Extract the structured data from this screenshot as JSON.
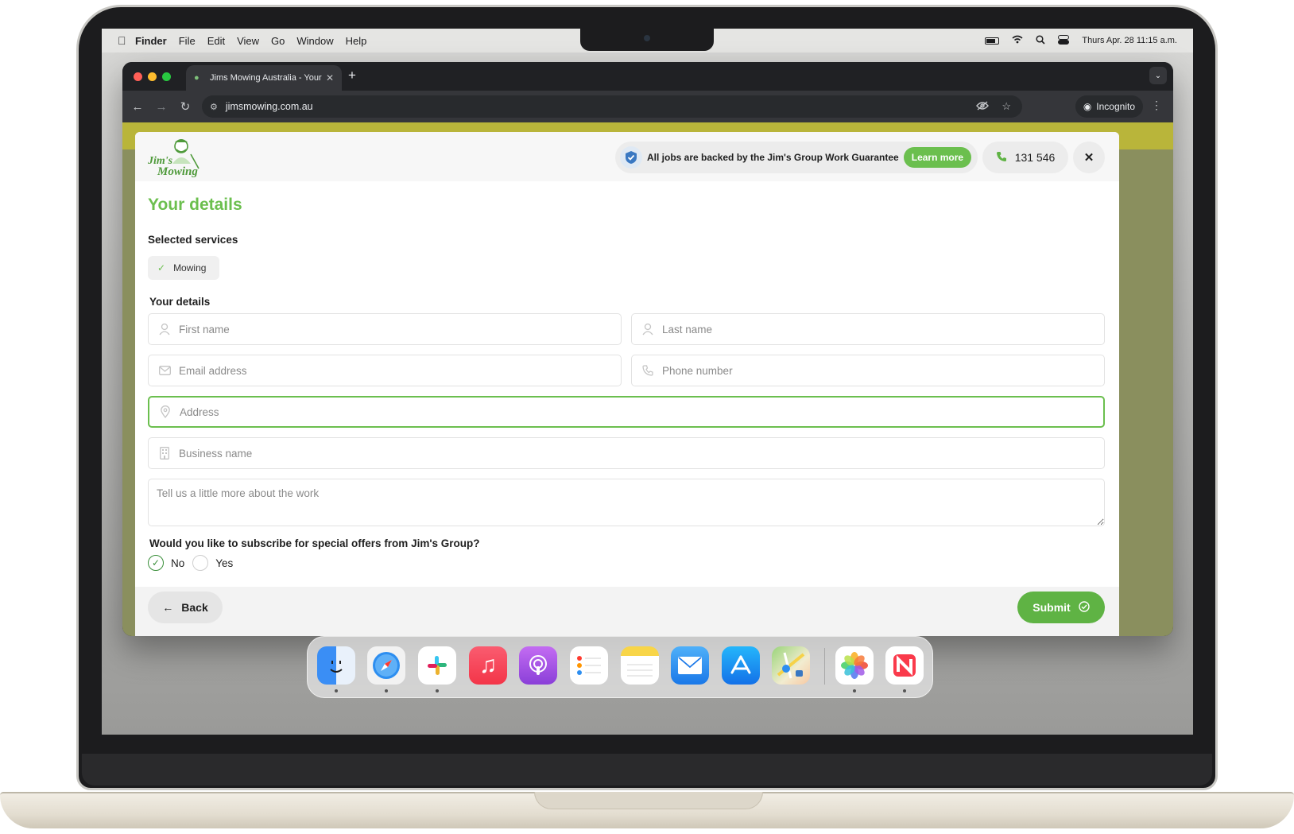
{
  "menubar": {
    "app_name": "Finder",
    "items": [
      "File",
      "Edit",
      "View",
      "Go",
      "Window",
      "Help"
    ],
    "datetime": "Thurs Apr. 28 11:15 a.m."
  },
  "browser": {
    "tab_title": "Jims Mowing Australia - Your",
    "url": "jimsmowing.com.au",
    "incognito_label": "Incognito"
  },
  "header": {
    "logo_text_line1": "Jim's",
    "logo_text_line2": "Mowing",
    "guarantee_text": "All jobs are backed by the Jim's Group Work Guarantee",
    "learn_more": "Learn more",
    "phone": "131 546"
  },
  "form": {
    "title": "Your details",
    "selected_services_label": "Selected services",
    "services": [
      "Mowing"
    ],
    "details_label": "Your details",
    "fields": {
      "first_name": "First name",
      "last_name": "Last name",
      "email": "Email address",
      "phone": "Phone number",
      "address": "Address",
      "business": "Business name",
      "notes": "Tell us a little more about the work"
    },
    "subscribe_question": "Would you like to subscribe for special offers from Jim's Group?",
    "subscribe_options": [
      "No",
      "Yes"
    ],
    "subscribe_selected": "No",
    "back_label": "Back",
    "submit_label": "Submit"
  },
  "dock": {
    "apps": [
      "Finder",
      "Safari",
      "Slack",
      "Music",
      "Podcasts",
      "Reminders",
      "Notes",
      "Mail",
      "App Store",
      "Maps",
      "Photos",
      "News"
    ]
  },
  "colors": {
    "brand_green": "#6bbf4e",
    "submit_green": "#5fb344"
  }
}
